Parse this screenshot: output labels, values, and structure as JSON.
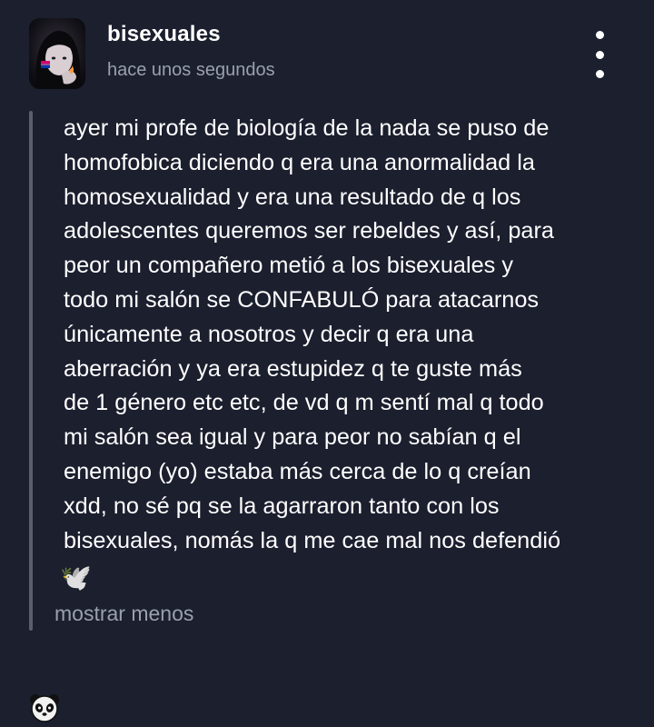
{
  "post": {
    "author": "bisexuales",
    "timestamp": "hace unos segundos",
    "body": "ayer mi profe de biología de la nada se puso de\nhomofobica diciendo q era una anormalidad la\nhomosexualidad y era una resultado de q los\nadolescentes queremos ser rebeldes y así, para\npeor un compañero metió a los bisexuales y\ntodo mi salón se CONFABULÓ para atacarnos\núnicamente a nosotros y decir q era una\naberración y ya era estupidez q te guste más\nde 1 género etc etc, de vd q m sentí mal q todo\nmi salón sea igual y para peor no sabían q el\nenemigo (yo) estaba más cerca de lo q creían\nxdd, no sé pq se la agarraron tanto con los\nbisexuales, nomás la q me cae mal nos defendió",
    "trailing_emoji": "🕊️",
    "show_less_label": "mostrar menos",
    "footer_emoji": "🐼"
  },
  "icons": {
    "more": "more-vertical-icon",
    "avatar_flag_colors": [
      "#d60270",
      "#9b4f96",
      "#0038a8"
    ]
  },
  "colors": {
    "background": "#1b1f2e",
    "text": "#ffffff",
    "muted": "#9aa0ad",
    "thread_line": "#5b5f6b"
  }
}
